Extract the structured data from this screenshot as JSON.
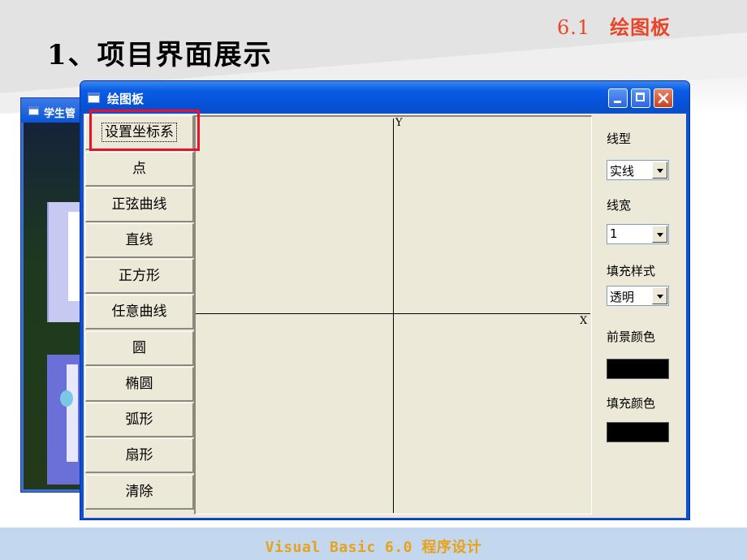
{
  "slide": {
    "section_number": "6.1",
    "section_name": "绘图板",
    "title": "1、项目界面展示",
    "footer": "Visual Basic 6.0 程序设计"
  },
  "background_window": {
    "title": "学生管"
  },
  "window": {
    "title": "绘图板",
    "buttons": [
      {
        "label": "设置坐标系"
      },
      {
        "label": "点"
      },
      {
        "label": "正弦曲线"
      },
      {
        "label": "直线"
      },
      {
        "label": "正方形"
      },
      {
        "label": "任意曲线"
      },
      {
        "label": "圆"
      },
      {
        "label": "椭圆"
      },
      {
        "label": "弧形"
      },
      {
        "label": "扇形"
      },
      {
        "label": "清除"
      }
    ],
    "canvas": {
      "y_axis_label": "Y",
      "x_axis_label": "X"
    },
    "panel": {
      "line_type_label": "线型",
      "line_type_value": "实线",
      "line_width_label": "线宽",
      "line_width_value": "1",
      "fill_style_label": "填充样式",
      "fill_style_value": "透明",
      "fore_color_label": "前景颜色",
      "fill_color_label": "填充颜色",
      "fore_color": "#000000",
      "fill_color": "#000000"
    }
  },
  "colors": {
    "highlight": "#e8102a",
    "section_tag": "#e8462a",
    "footer_text": "#e8a21a"
  }
}
